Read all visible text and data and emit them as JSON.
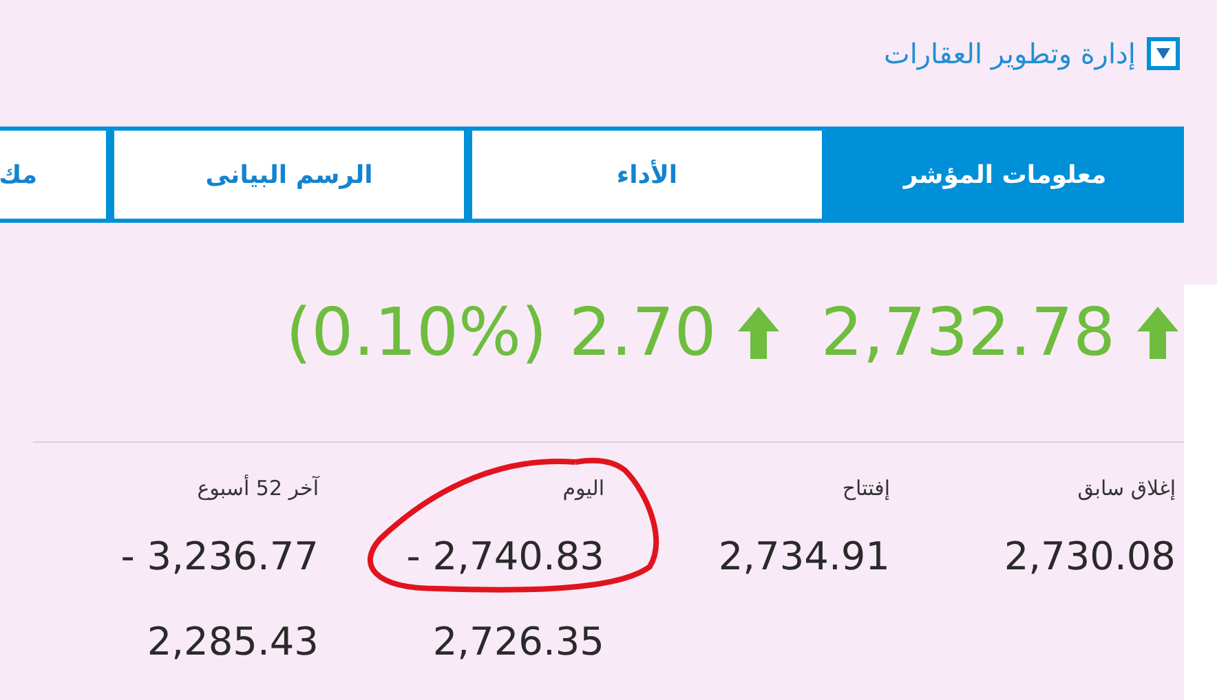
{
  "header": {
    "title": "إدارة وتطوير العقارات",
    "expanded": false
  },
  "tabs": [
    {
      "label": "معلومات المؤشر",
      "selected": true
    },
    {
      "label": "الأداء",
      "selected": false
    },
    {
      "label": "الرسم البيانى",
      "selected": false
    },
    {
      "label": "مك",
      "selected": false
    }
  ],
  "quote": {
    "value": "2,732.78",
    "change": "2.70",
    "percent": "(0.10%)"
  },
  "stats": [
    {
      "label": "إغلاق سابق",
      "values": [
        "2,730.08"
      ],
      "highlighted": false
    },
    {
      "label": "إفتتاح",
      "values": [
        "2,734.91"
      ],
      "highlighted": false
    },
    {
      "label": "اليوم",
      "values": [
        "- 2,740.83",
        "2,726.35"
      ],
      "highlighted": true
    },
    {
      "label": "آخر 52 أسبوع",
      "values": [
        "- 3,236.77",
        "2,285.43"
      ],
      "highlighted": false
    }
  ]
}
